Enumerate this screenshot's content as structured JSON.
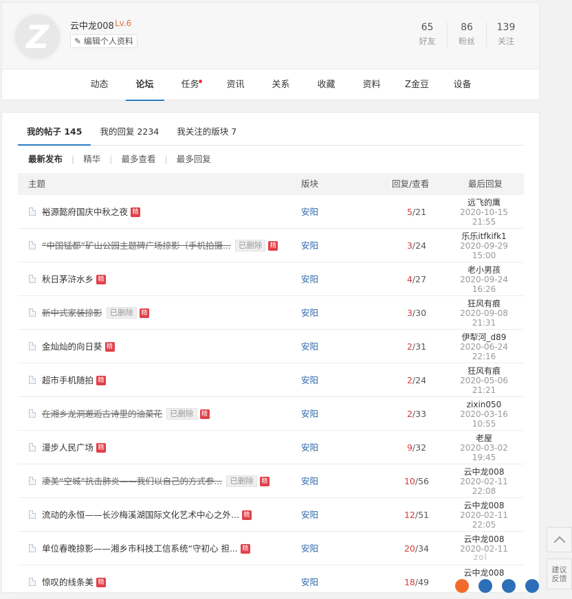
{
  "profile": {
    "username": "云中龙008",
    "level": "Lv.6",
    "avatar_letter": "Z",
    "edit_label": "编辑个人资料",
    "stats": [
      {
        "num": "65",
        "label": "好友"
      },
      {
        "num": "86",
        "label": "粉丝"
      },
      {
        "num": "139",
        "label": "关注"
      }
    ]
  },
  "nav": {
    "items": [
      "动态",
      "论坛",
      "任务",
      "资讯",
      "关系",
      "收藏",
      "资料",
      "Z金豆",
      "设备"
    ],
    "active": "论坛"
  },
  "tabs": [
    "我的帖子 145",
    "我的回复 2234",
    "我关注的版块 7"
  ],
  "filters": [
    "最新发布",
    "精华",
    "最多查看",
    "最多回复"
  ],
  "table": {
    "headers": {
      "subject": "主题",
      "board": "版块",
      "counts": "回复/查看",
      "last": "最后回复"
    },
    "jing_label": "精",
    "deleted_label": "已删除",
    "rows": [
      {
        "title": "裕源懿府国庆中秋之夜",
        "deleted": false,
        "board": "安阳",
        "replies": "5",
        "views": "21",
        "user": "远飞的鹰",
        "date": "2020-10-15",
        "time": "21:55"
      },
      {
        "title": "“中国锰都”矿山公园主题碑广场掠影（手机拍摄...",
        "deleted": true,
        "board": "安阳",
        "replies": "3",
        "views": "24",
        "user": "乐乐itfkifk1",
        "date": "2020-09-29",
        "time": "15:00"
      },
      {
        "title": "秋日茅浒水乡",
        "deleted": false,
        "board": "安阳",
        "replies": "4",
        "views": "27",
        "user": "老小男孩",
        "date": "2020-09-24",
        "time": "16:26"
      },
      {
        "title": "新中式家装掠影",
        "deleted": true,
        "board": "安阳",
        "replies": "3",
        "views": "30",
        "user": "狂风有痕",
        "date": "2020-09-08",
        "time": "21:31"
      },
      {
        "title": "金灿灿的向日葵",
        "deleted": false,
        "board": "安阳",
        "replies": "2",
        "views": "31",
        "user": "伊犁河_d89",
        "date": "2020-06-24",
        "time": "22:16"
      },
      {
        "title": "超市手机随拍",
        "deleted": false,
        "board": "安阳",
        "replies": "2",
        "views": "24",
        "user": "狂风有痕",
        "date": "2020-05-06",
        "time": "21:21"
      },
      {
        "title": "在湘乡龙洞邂逅古诗里的油菜花",
        "deleted": true,
        "board": "安阳",
        "replies": "2",
        "views": "33",
        "user": "zixin050",
        "date": "2020-03-16",
        "time": "10:55"
      },
      {
        "title": "漫步人民广场",
        "deleted": false,
        "board": "安阳",
        "replies": "9",
        "views": "32",
        "user": "老屋",
        "date": "2020-03-02",
        "time": "19:45"
      },
      {
        "title": "凄美“空城”抗击肺炎——我们以自己的方式参...",
        "deleted": true,
        "board": "安阳",
        "replies": "10",
        "views": "56",
        "user": "云中龙008",
        "date": "2020-02-11",
        "time": "22:08"
      },
      {
        "title": "流动的永恒——长沙梅溪湖国际文化艺术中心之外...",
        "deleted": false,
        "board": "安阳",
        "replies": "12",
        "views": "51",
        "user": "云中龙008",
        "date": "2020-02-11",
        "time": "22:05"
      },
      {
        "title": "单位春晚掠影——湘乡市科技工信系统“守初心 担...",
        "deleted": false,
        "board": "安阳",
        "replies": "20",
        "views": "34",
        "user": "云中龙008",
        "date": "2020-02-11",
        "time": ""
      },
      {
        "title": "惊叹的线条美",
        "deleted": false,
        "board": "安阳",
        "replies": "18",
        "views": "49",
        "user": "云中龙008",
        "date": "",
        "time": ""
      }
    ]
  },
  "side": {
    "feedback_line1": "建议",
    "feedback_line2": "反馈"
  },
  "watermark": "zol"
}
